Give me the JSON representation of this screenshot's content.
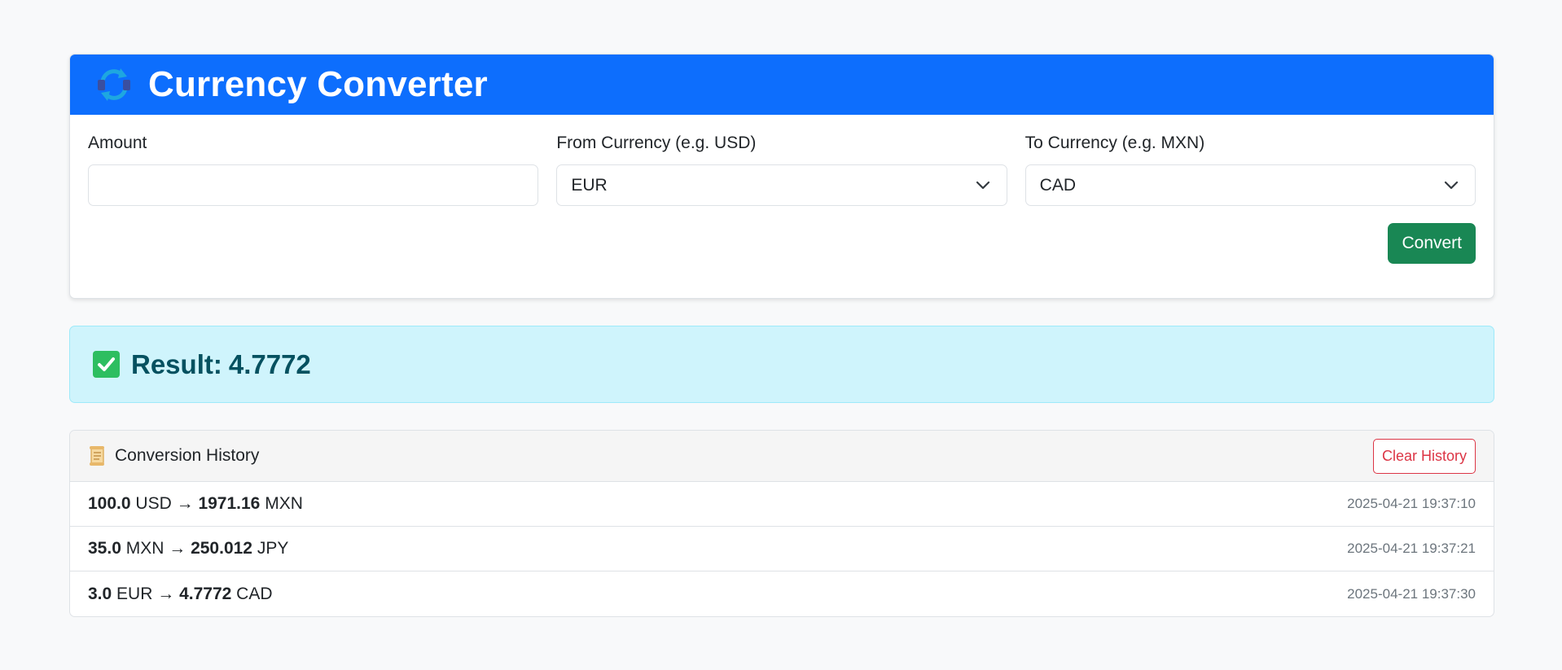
{
  "header": {
    "title": "Currency Converter",
    "icon": "currency-exchange-icon"
  },
  "form": {
    "amount_label": "Amount",
    "amount_value": "",
    "from_label": "From Currency (e.g. USD)",
    "from_value": "EUR",
    "to_label": "To Currency (e.g. MXN)",
    "to_value": "CAD",
    "convert_label": "Convert"
  },
  "result": {
    "label": "Result:",
    "value": "4.7772",
    "icon": "check-box-icon"
  },
  "history": {
    "title": "Conversion History",
    "icon": "scroll-icon",
    "clear_label": "Clear History",
    "entries": [
      {
        "amount": "100.0",
        "from": "USD",
        "arrow": "→",
        "converted": "1971.16",
        "to": "MXN",
        "timestamp": "2025-04-21 19:37:10"
      },
      {
        "amount": "35.0",
        "from": "MXN",
        "arrow": "→",
        "converted": "250.012",
        "to": "JPY",
        "timestamp": "2025-04-21 19:37:21"
      },
      {
        "amount": "3.0",
        "from": "EUR",
        "arrow": "→",
        "converted": "4.7772",
        "to": "CAD",
        "timestamp": "2025-04-21 19:37:30"
      }
    ]
  },
  "colors": {
    "primary": "#0d6efd",
    "success": "#198754",
    "info_bg": "#cff4fc",
    "info_text": "#055160",
    "danger": "#dc3545"
  }
}
